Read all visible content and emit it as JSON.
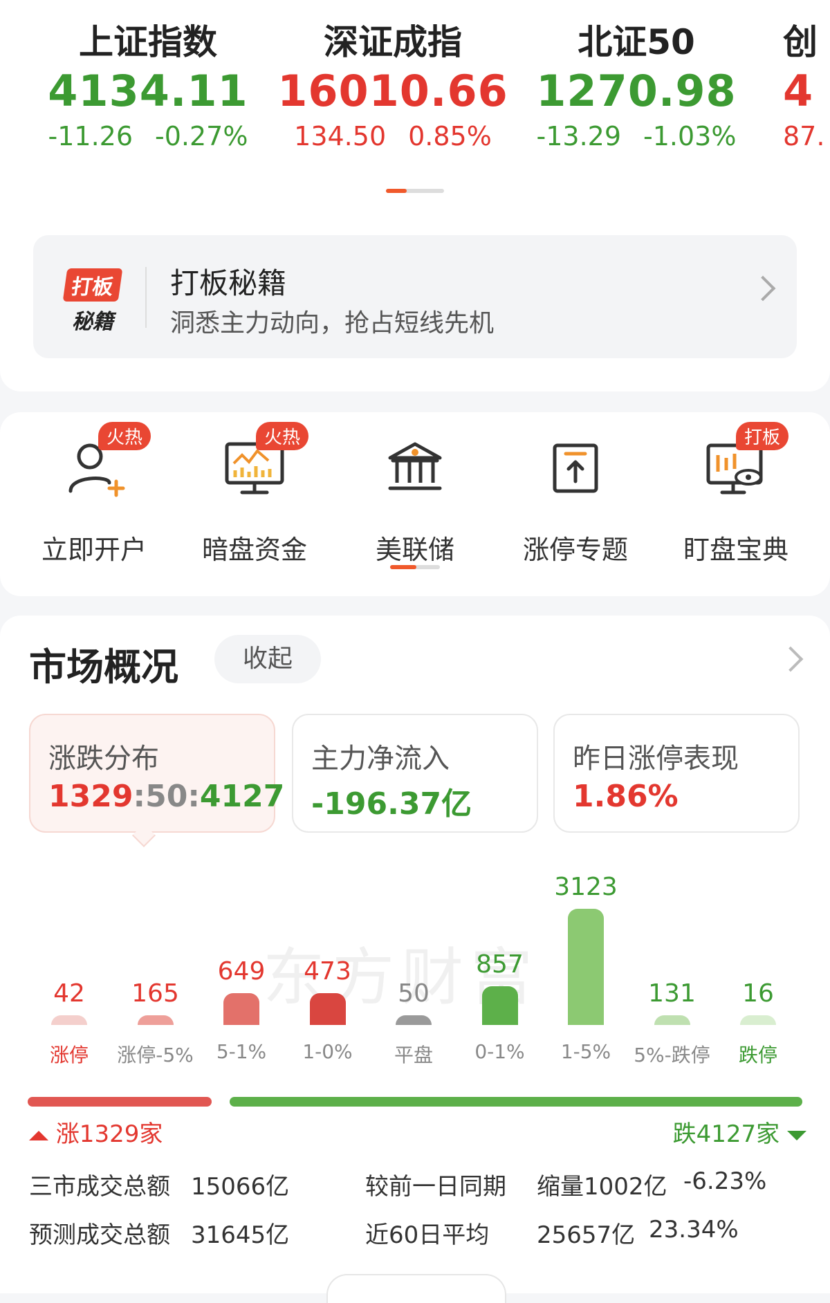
{
  "indices": [
    {
      "name": "上证指数",
      "value": "4134.11",
      "change": "-11.26",
      "pct": "-0.27%",
      "color": "#3c9a32"
    },
    {
      "name": "深证成指",
      "value": "16010.66",
      "change": "134.50",
      "pct": "0.85%",
      "color": "#e3372f"
    },
    {
      "name": "北证50",
      "value": "1270.98",
      "change": "-13.29",
      "pct": "-1.03%",
      "color": "#3c9a32"
    },
    {
      "name": "创",
      "value": "4",
      "change": "87.",
      "pct": "",
      "color": "#e3372f"
    }
  ],
  "banner": {
    "logo_top": "打板",
    "logo_bottom": "秘籍",
    "title": "打板秘籍",
    "subtitle": "洞悉主力动向，抢占短线先机"
  },
  "shortcuts": [
    {
      "label": "立即开户",
      "badge": "火热",
      "icon": "user-add-icon"
    },
    {
      "label": "暗盘资金",
      "badge": "火热",
      "icon": "monitor-chart-icon"
    },
    {
      "label": "美联储",
      "badge": "",
      "icon": "bank-icon"
    },
    {
      "label": "涨停专题",
      "badge": "",
      "icon": "up-box-icon"
    },
    {
      "label": "盯盘宝典",
      "badge": "打板",
      "icon": "monitor-eye-icon"
    }
  ],
  "market": {
    "title": "市场概况",
    "collapse_label": "收起",
    "tiles": [
      {
        "label": "涨跌分布",
        "value_up": "1329",
        "sep1": ":",
        "value_flat": "50",
        "sep2": ":",
        "value_down": "4127"
      },
      {
        "label": "主力净流入",
        "value": "-196.37亿"
      },
      {
        "label": "昨日涨停表现",
        "value": "1.86%"
      }
    ],
    "watermark": "东方财富"
  },
  "chart_data": {
    "type": "bar",
    "categories": [
      "涨停",
      "涨停-5%",
      "5-1%",
      "1-0%",
      "平盘",
      "0-1%",
      "1-5%",
      "5%-跌停",
      "跌停"
    ],
    "values": [
      42,
      165,
      649,
      473,
      50,
      857,
      3123,
      131,
      16
    ],
    "colors": [
      "#f4cfcc",
      "#ee9f99",
      "#e3716a",
      "#d94640",
      "#9a9a9a",
      "#5db04a",
      "#8cc972",
      "#bfe0b0",
      "#d9eed0"
    ],
    "value_colors": [
      "#e3372f",
      "#e3372f",
      "#e3372f",
      "#e3372f",
      "#888888",
      "#3c9a32",
      "#3c9a32",
      "#3c9a32",
      "#3c9a32"
    ],
    "label_colors": [
      "#e3372f",
      "#888888",
      "#888888",
      "#888888",
      "#888888",
      "#888888",
      "#888888",
      "#888888",
      "#3c9a32"
    ]
  },
  "ratio": {
    "up": 1329,
    "down": 4127,
    "up_label": "涨1329家",
    "down_label": "跌4127家"
  },
  "stats": {
    "total_label": "三市成交总额",
    "total_value": "15066亿",
    "compare_label": "较前一日同期",
    "compare_value": "缩量1002亿",
    "compare_pct": "-6.23%",
    "forecast_label": "预测成交总额",
    "forecast_value": "31645亿",
    "avg_label": "近60日平均",
    "avg_value": "25657亿",
    "avg_pct": "23.34%"
  }
}
